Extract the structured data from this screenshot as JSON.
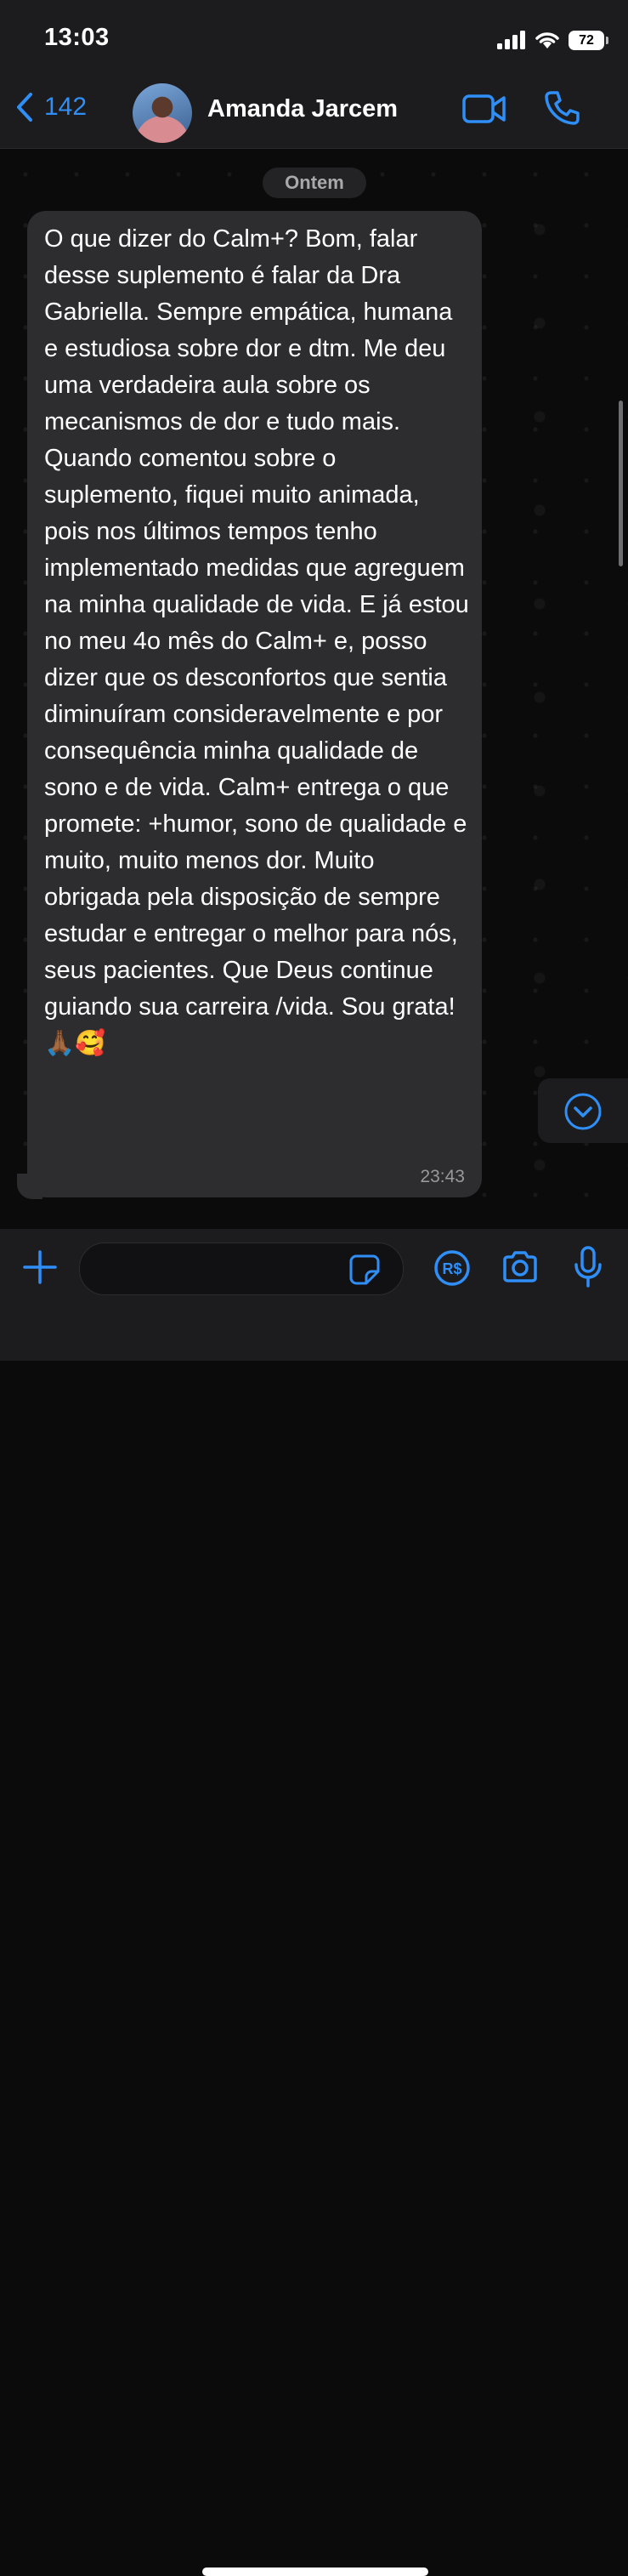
{
  "status_bar": {
    "time": "13:03",
    "battery": "72"
  },
  "header": {
    "back_count": "142",
    "contact_name": "Amanda Jarcem"
  },
  "chat": {
    "date_label": "Ontem",
    "message": {
      "text": "O que dizer do Calm+? Bom, falar desse suplemento é falar da Dra Gabriella. Sempre empática, humana e estudiosa sobre dor e dtm. Me deu uma verdadeira aula sobre os mecanismos de dor e tudo mais. Quando comentou sobre o suplemento, fiquei muito animada,  pois nos últimos tempos tenho implementado medidas que agreguem na minha qualidade de vida. E já estou no meu 4o mês do Calm+ e, posso dizer que os desconfortos que sentia diminuíram consideravelmente e por consequência minha qualidade de sono e de vida. Calm+ entrega o que promete: +humor, sono de qualidade e muito, muito menos dor. Muito obrigada pela disposição de sempre estudar e entregar o melhor para nós, seus pacientes. Que Deus continue guiando sua carreira /vida. Sou grata! 🙏🏾🥰",
      "time": "23:43"
    }
  },
  "icons": {
    "back": "chevron-left-icon",
    "video": "video-camera-icon",
    "call": "phone-icon",
    "scroll_down": "chevron-down-circle-icon",
    "plus": "plus-icon",
    "sticker": "sticker-icon",
    "pix": "currency-real-icon",
    "camera": "camera-icon",
    "mic": "microphone-icon"
  },
  "colors": {
    "accent": "#2f8ff7",
    "bubble": "#2d2d2f",
    "bar": "#1c1c1e",
    "background": "#0b0b0b"
  }
}
